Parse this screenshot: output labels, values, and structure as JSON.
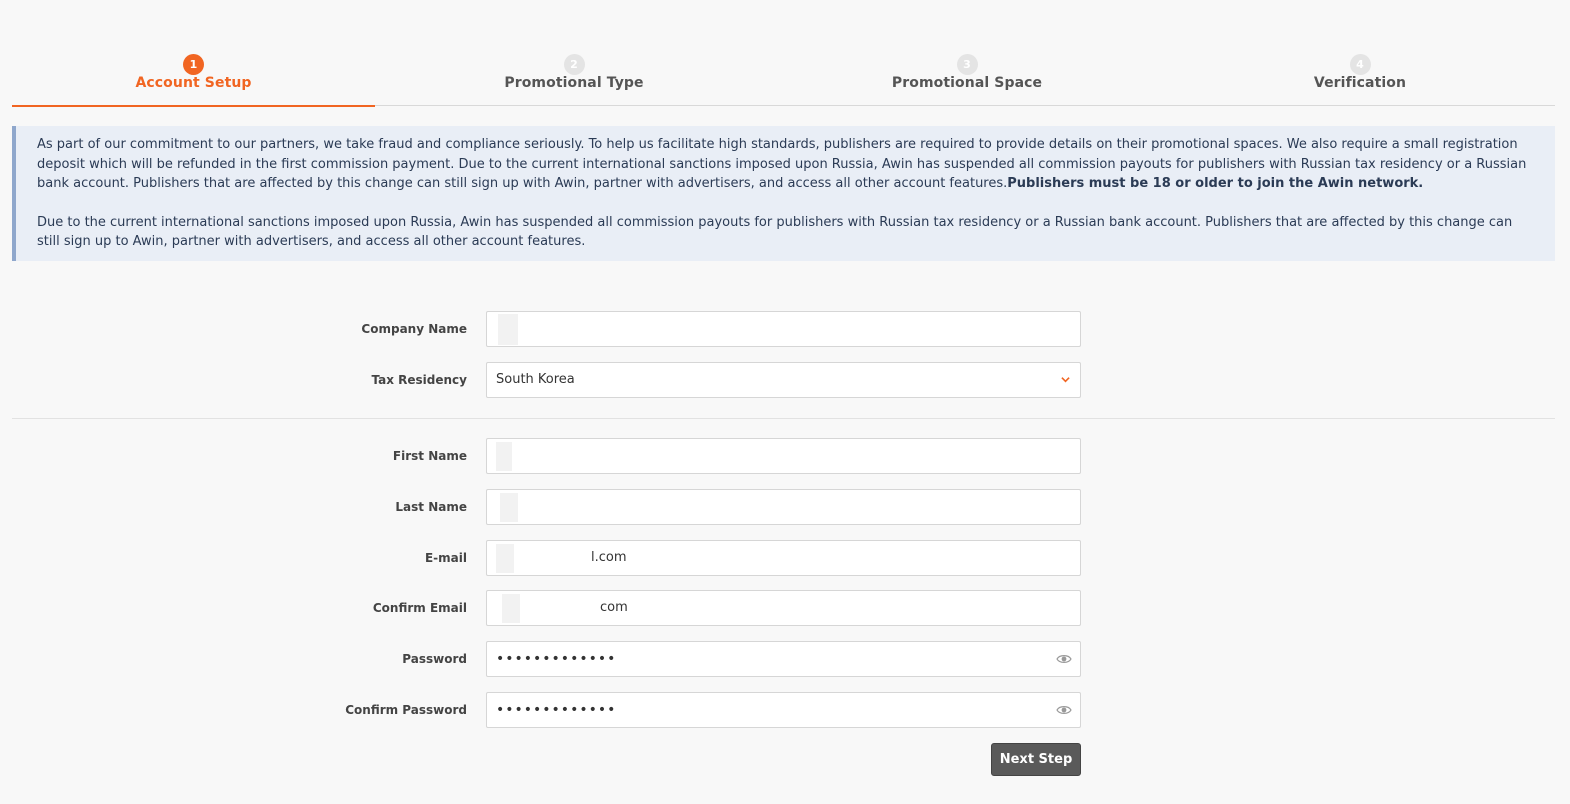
{
  "stepper": {
    "steps": [
      {
        "number": "1",
        "label": "Account Setup"
      },
      {
        "number": "2",
        "label": "Promotional Type"
      },
      {
        "number": "3",
        "label": "Promotional Space"
      },
      {
        "number": "4",
        "label": "Verification"
      }
    ],
    "active_step": 1
  },
  "notice": {
    "paragraph1_text": "As part of our commitment to our partners, we take fraud and compliance seriously. To help us facilitate high standards, publishers are required to provide details on their promotional spaces. We also require a small registration deposit which will be refunded in the first commission payment. Due to the current international sanctions imposed upon Russia, Awin has suspended all commission payouts for publishers with Russian tax residency or a Russian bank account. Publishers that are affected by this change can still sign up with Awin, partner with advertisers, and access all other account features.",
    "paragraph1_bold": "Publishers must be 18 or older to join the Awin network.",
    "paragraph2_text": "Due to the current international sanctions imposed upon Russia, Awin has suspended all commission payouts for publishers with Russian tax residency or a Russian bank account. Publishers that are affected by this change can still sign up to Awin, partner with advertisers, and access all other account features."
  },
  "form": {
    "company_name": {
      "label": "Company Name",
      "value": ""
    },
    "tax_residency": {
      "label": "Tax Residency",
      "value": "South Korea"
    },
    "first_name": {
      "label": "First Name",
      "value": ""
    },
    "last_name": {
      "label": "Last Name",
      "value": ""
    },
    "email": {
      "label": "E-mail",
      "value": "l.com"
    },
    "confirm_email": {
      "label": "Confirm Email",
      "value": "com"
    },
    "password": {
      "label": "Password",
      "value": "•••••••••••••"
    },
    "confirm_password": {
      "label": "Confirm Password",
      "value": "•••••••••••••"
    },
    "next_button_label": "Next Step"
  },
  "colors": {
    "accent": "#f16522",
    "notice_bg": "#e9eef6",
    "notice_border": "#8fa7cc",
    "button_bg": "#5a5a5a"
  }
}
